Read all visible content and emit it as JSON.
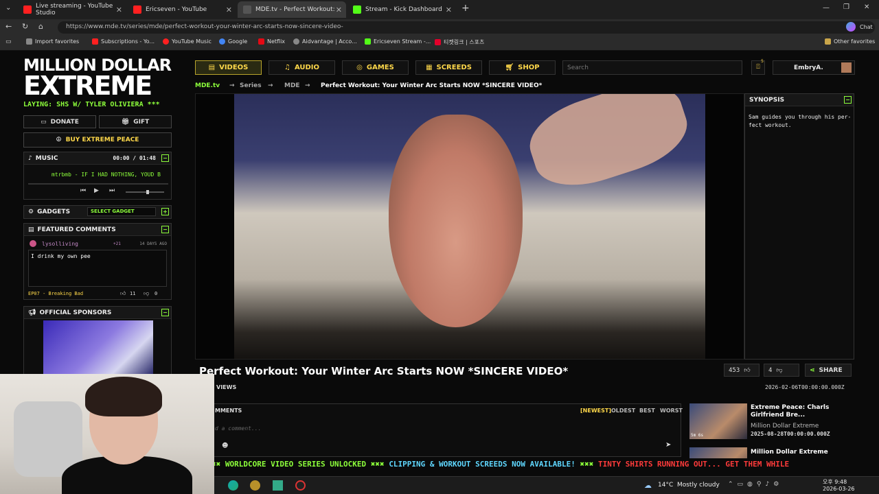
{
  "browser": {
    "tabs": [
      {
        "label": "Live streaming - YouTube Studio",
        "color": "#ff2020"
      },
      {
        "label": "Ericseven - YouTube",
        "color": "#ff2020"
      },
      {
        "label": "MDE.tv - Perfect Workout: Yo",
        "color": "#aaaaaa"
      },
      {
        "label": "Stream - Kick Dashboard",
        "color": "#53fc18"
      }
    ],
    "url": "https://www.mde.tv/series/mde/perfect-workout-your-winter-arc-starts-now-sincere-video-",
    "chat_label": "Chat",
    "bookmarks": [
      {
        "label": "Import favorites",
        "color": "#888888"
      },
      {
        "label": "Subscriptions - Yo...",
        "color": "#ff2020"
      },
      {
        "label": "YouTube Music",
        "color": "#ff2020"
      },
      {
        "label": "Google",
        "color": "#4285f4"
      },
      {
        "label": "Netflix",
        "color": "#e50914"
      },
      {
        "label": "Aidvantage | Acco...",
        "color": "#888888"
      },
      {
        "label": "Ericseven Stream -...",
        "color": "#53fc18"
      },
      {
        "label": "티켓링크 | 스포츠",
        "color": "#e4002b"
      }
    ],
    "other_favorites": "Other favorites"
  },
  "sidebar": {
    "logo_line1": "MILLION DOLLAR",
    "logo_line2": "EXTREME",
    "playing": "LAYING: SHS W/ TYLER OLIVIERA ***",
    "donate": "DONATE",
    "gift": "GIFT",
    "buy": "BUY EXTREME PEACE",
    "music": {
      "title": "MUSIC",
      "time": "00:00 / 01:48",
      "track": "mtrbmb - IF I HAD NOTHING, YOUD B"
    },
    "gadgets": {
      "title": "GADGETS",
      "select": "SELECT GADGET"
    },
    "featured": {
      "title": "FEATURED COMMENTS",
      "user": "lysolliving",
      "badge": "+21",
      "age": "14 DAYS AGO",
      "text": "I drink my own pee",
      "episode": "EP07 - Breaking Bad",
      "likes": "11",
      "dislikes": "0"
    },
    "sponsors": {
      "title": "OFFICIAL SPONSORS"
    }
  },
  "nav": {
    "items": [
      "VIDEOS",
      "AUDIO",
      "GAMES",
      "SCREEDS",
      "SHOP"
    ],
    "search_placeholder": "Search",
    "user": "EmbryA.",
    "notif_count": "5"
  },
  "breadcrumb": {
    "items": [
      "MDE.tv",
      "Series",
      "MDE",
      "Perfect Workout: Your Winter Arc Starts NOW *SINCERE VIDEO*"
    ]
  },
  "video": {
    "title": "Perfect Workout: Your Winter Arc Starts NOW *SINCERE VIDEO*",
    "likes": "453",
    "dislikes": "4",
    "share": "SHARE",
    "views_label": "VIEWS",
    "date": "2026-02-06T00:00:00.000Z"
  },
  "synopsis": {
    "title": "SYNOPSIS",
    "text": "Sam guides you through his per-fect workout."
  },
  "comments": {
    "title": "MMENTS",
    "sort": [
      "[NEWEST]",
      "OLDEST",
      "BEST",
      "WORST"
    ],
    "placeholder": "d a comment..."
  },
  "related": [
    {
      "title": "Extreme Peace: Charls Girlfriend Bre...",
      "channel": "Million Dollar Extreme",
      "date": "2025-08-28T00:00:00.000Z",
      "duration": "5m 6s"
    },
    {
      "title": "Million Dollar Extreme",
      "channel": "",
      "date": "",
      "duration": ""
    }
  ],
  "ticker": [
    {
      "text": "WORLDCORE VIDEO SERIES UNLOCKED",
      "color": "#8dff3b"
    },
    {
      "text": "CLIPPING & WORKOUT SCREEDS NOW AVAILABLE!",
      "color": "#5fd7ff"
    },
    {
      "text": "TINTY SHIRTS RUNNING OUT... GET THEM WHILE",
      "color": "#ff3b3b"
    }
  ],
  "taskbar": {
    "weather": "14°C  Mostly cloudy",
    "time": "오후 9:48",
    "date": "2026-03-26"
  },
  "colors": {
    "accent": "#8dff3b",
    "nav_text": "#ffd84a"
  }
}
